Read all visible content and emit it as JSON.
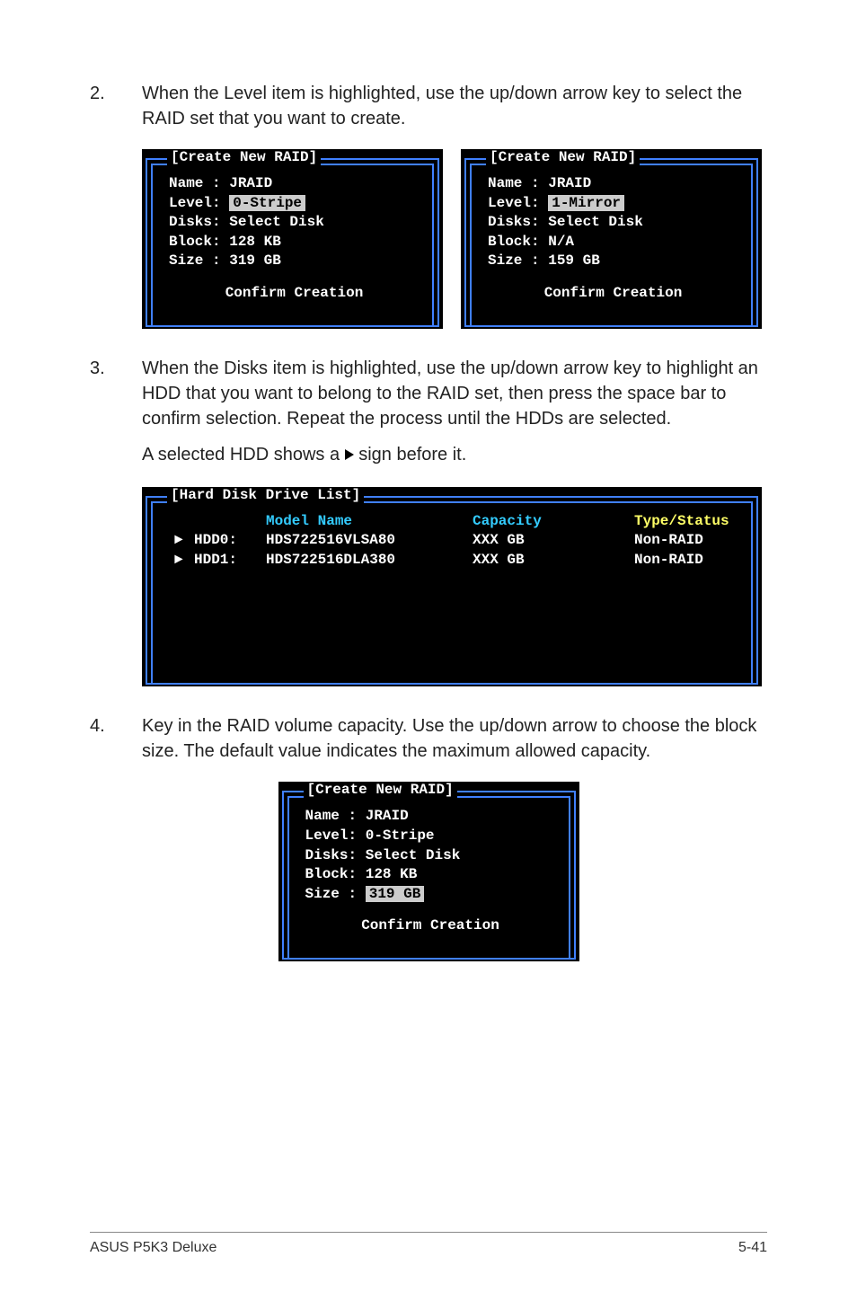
{
  "step2": {
    "num": "2.",
    "text": "When the Level item is highlighted, use the up/down arrow key to select the RAID set that you want to create."
  },
  "panel_left": {
    "title": "[Create New RAID]",
    "l1a": "Name :",
    "l1b": " JRAID",
    "l2a": "Level:",
    "l2b": "0-Stripe",
    "l3": "Disks: Select Disk",
    "l4": "Block: 128 KB",
    "l5": "Size : 319 GB",
    "confirm": "Confirm Creation"
  },
  "panel_right": {
    "title": "[Create New RAID]",
    "l1a": "Name :",
    "l1b": " JRAID",
    "l2a": "Level:",
    "l2b": "1-Mirror",
    "l3": "Disks: Select Disk",
    "l4": "Block: N/A",
    "l5": "Size : 159 GB",
    "confirm": "Confirm Creation"
  },
  "step3": {
    "num": "3.",
    "text": "When the Disks item is highlighted, use the up/down arrow key to highlight an HDD that you want to belong to the RAID set, then press the space bar to confirm selection. Repeat the process until the HDDs are selected.",
    "note_a": "A selected HDD shows a ",
    "note_b": " sign before it."
  },
  "panel_list": {
    "title": "[Hard Disk Drive List]",
    "h_model": "Model Name",
    "h_cap": "Capacity",
    "h_type": "Type/Status",
    "r0_id": "HDD0:",
    "r0_model": "HDS722516VLSA80",
    "r0_cap": "XXX GB",
    "r0_type": "Non-RAID",
    "r1_id": "HDD1:",
    "r1_model": "HDS722516DLA380",
    "r1_cap": "XXX GB",
    "r1_type": "Non-RAID"
  },
  "step4": {
    "num": "4.",
    "text": "Key in the RAID volume capacity. Use the up/down arrow to choose the block size. The default value indicates the maximum allowed capacity."
  },
  "panel_size": {
    "title": "[Create New RAID]",
    "l1": "Name : JRAID",
    "l2": "Level: 0-Stripe",
    "l3": "Disks: Select Disk",
    "l4": "Block: 128 KB",
    "l5a": "Size :",
    "l5b": "319 GB",
    "confirm": "Confirm Creation"
  },
  "footer": {
    "left": "ASUS P5K3 Deluxe",
    "right": "5-41"
  }
}
